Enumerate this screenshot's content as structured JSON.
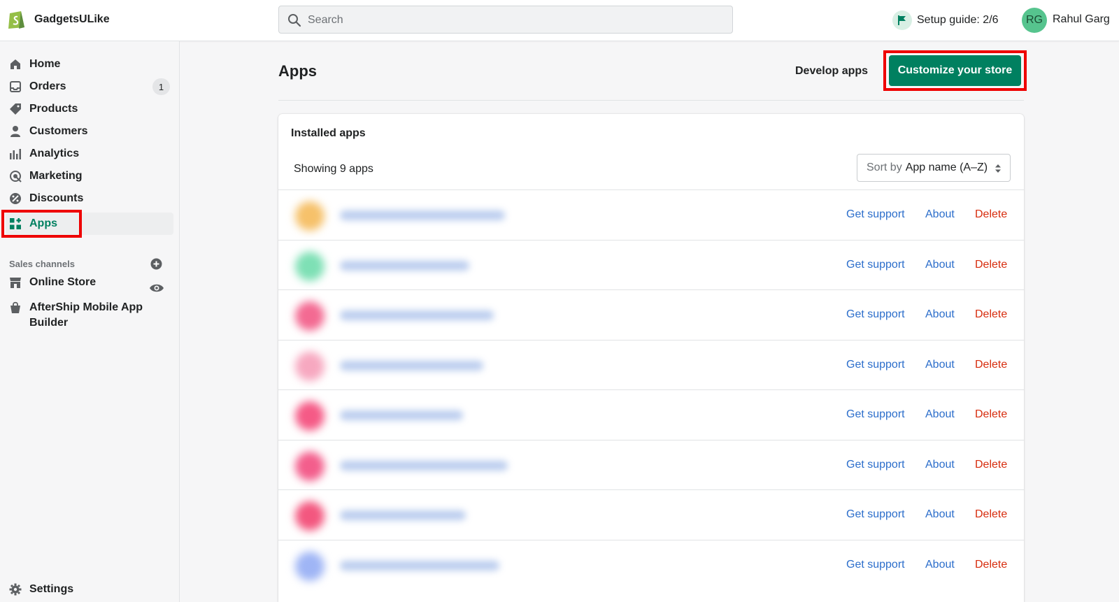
{
  "topbar": {
    "store_name": "GadgetsULike",
    "search_placeholder": "Search",
    "setup_guide": "Setup guide: 2/6",
    "avatar_initials": "RG",
    "user_name": "Rahul Garg"
  },
  "sidebar": {
    "items": [
      {
        "label": "Home",
        "icon": "home-icon"
      },
      {
        "label": "Orders",
        "icon": "orders-icon",
        "badge": "1"
      },
      {
        "label": "Products",
        "icon": "tag-icon"
      },
      {
        "label": "Customers",
        "icon": "person-icon"
      },
      {
        "label": "Analytics",
        "icon": "bar-chart-icon"
      },
      {
        "label": "Marketing",
        "icon": "target-icon"
      },
      {
        "label": "Discounts",
        "icon": "discount-icon"
      },
      {
        "label": "Apps",
        "icon": "apps-icon",
        "active": true
      }
    ],
    "sales_channels_label": "Sales channels",
    "channels": [
      {
        "label": "Online Store",
        "icon": "store-icon"
      },
      {
        "label_line1": "AfterShip Mobile App",
        "label_line2": "Builder",
        "icon": "bag-icon"
      }
    ],
    "settings_label": "Settings"
  },
  "main": {
    "title": "Apps",
    "develop_apps": "Develop apps",
    "customize_button": "Customize your store",
    "card": {
      "title": "Installed apps",
      "showing": "Showing 9 apps",
      "sort_prefix": "Sort by",
      "sort_value": "App name (A–Z)",
      "actions": {
        "support": "Get support",
        "about": "About",
        "delete": "Delete"
      }
    }
  },
  "colors": {
    "primary": "#008060",
    "link": "#2c6ecb",
    "danger": "#d72c0d",
    "highlight": "#ee0000"
  }
}
